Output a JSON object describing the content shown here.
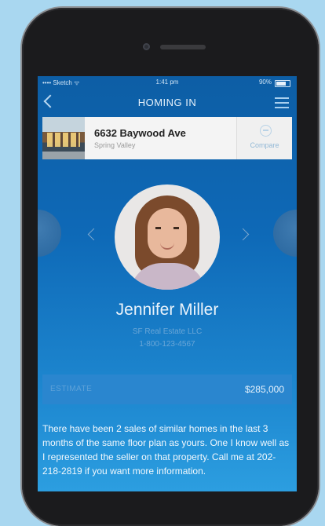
{
  "status_bar": {
    "carrier": "•••• Sketch ᯤ",
    "time": "1:41 pm",
    "battery": "90%"
  },
  "nav": {
    "title": "HOMING IN",
    "back_icon": "chevron-left-icon",
    "menu_icon": "hamburger-icon"
  },
  "listing": {
    "address": "6632 Baywood Ave",
    "city": "Spring Valley",
    "compare_label": "Compare",
    "compare_icon": "compare-icon"
  },
  "agent": {
    "name": "Jennifer Miller",
    "company": "SF Real Estate LLC",
    "phone": "1-800-123-4567"
  },
  "estimate": {
    "label": "ESTIMATE",
    "value": "$285,000"
  },
  "message": "There have been 2 sales of similar homes in the last 3 months of the same floor plan as yours.  One I know well as I represented the seller on that property.  Call me at 202-218-2819 if you want more information.",
  "colors": {
    "background": "#a9d7f0",
    "screen_top": "#0d5ea5",
    "screen_bottom": "#2c9ee0"
  }
}
